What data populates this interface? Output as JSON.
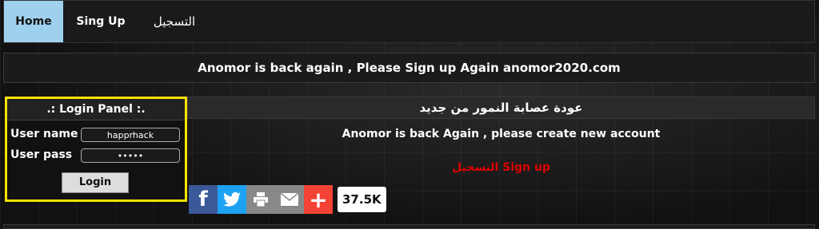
{
  "nav": {
    "home": "Home",
    "signup": "Sing Up",
    "register": "التسجيل"
  },
  "announcement": "Anomor is back again , Please Sign up Again anomor2020.com",
  "login": {
    "title": ".: Login Panel :.",
    "username_label": "User name",
    "username_value": "happrhack",
    "password_label": "User pass",
    "password_value": "•••••",
    "button": "Login"
  },
  "main": {
    "arabic_title": "عودة عصابة النمور من جديد",
    "message": "Anomor is back Again , please create new account",
    "signup_link": "التسجيل Sign up"
  },
  "share": {
    "count": "37.5K",
    "icons": [
      "facebook-icon",
      "twitter-icon",
      "print-icon",
      "email-icon",
      "plus-icon"
    ]
  }
}
